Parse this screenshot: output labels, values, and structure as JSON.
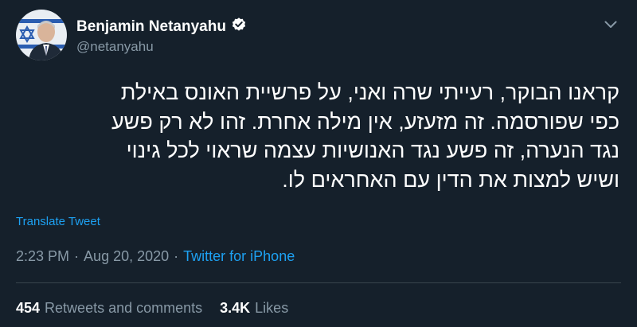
{
  "author": {
    "name": "Benjamin Netanyahu",
    "handle": "@netanyahu"
  },
  "tweet": {
    "lines": [
      "קראנו הבוקר, רעייתי שרה ואני, על פרשיית האונס באילת",
      "כפי שפורסמה. זה מזעזע, אין מילה אחרת. זהו לא רק פשע",
      "נגד הנערה, זה פשע נגד האנושיות עצמה שראוי לכל גינוי",
      "ושיש למצות את הדין עם האחראים לו."
    ],
    "translate_label": "Translate Tweet"
  },
  "meta": {
    "time": "2:23 PM",
    "sep1": "·",
    "date": "Aug 20, 2020",
    "sep2": "·",
    "source": "Twitter for iPhone"
  },
  "stats": {
    "retweets_count": "454",
    "retweets_label": "Retweets and comments",
    "likes_count": "3.4K",
    "likes_label": "Likes"
  },
  "colors": {
    "background": "#15202b",
    "accent": "#1da1f2",
    "secondary_text": "#8899a6",
    "divider": "#38444d"
  },
  "icons": {
    "verified": "verified-badge-icon",
    "more": "chevron-down-icon"
  }
}
